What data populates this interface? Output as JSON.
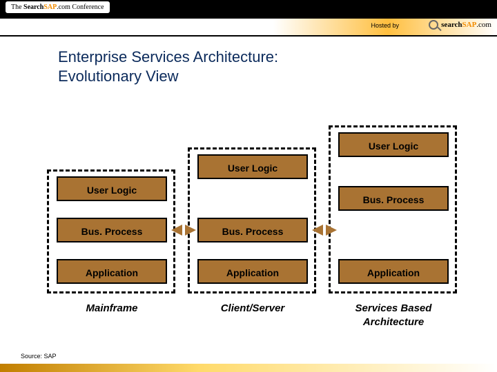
{
  "header": {
    "badge_prefix": "The ",
    "badge_search": "Search",
    "badge_sap": "SAP",
    "badge_suffix": ".com Conference",
    "hosted_by": "Hosted by",
    "logo_search": "search",
    "logo_sap": "SAP",
    "logo_suffix": ".com"
  },
  "title_line1": "Enterprise Services Architecture:",
  "title_line2": "Evolutionary View",
  "boxes": {
    "user_logic": "User Logic",
    "bus_process": "Bus. Process",
    "application": "Application"
  },
  "columns": {
    "c1": "Mainframe",
    "c2": "Client/Server",
    "c3_a": "Services Based",
    "c3_b": "Architecture"
  },
  "source": "Source: SAP"
}
